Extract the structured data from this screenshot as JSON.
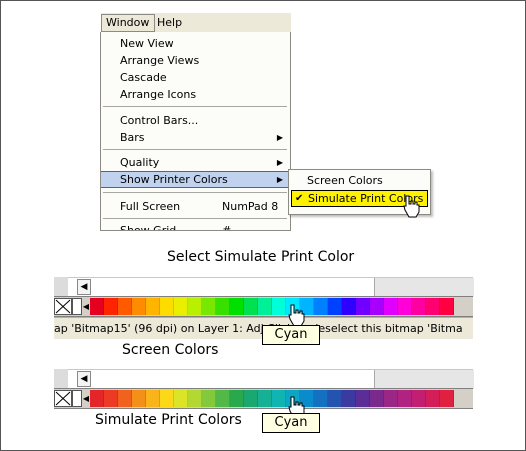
{
  "menubar": {
    "items": [
      "Window",
      "Help"
    ]
  },
  "window_menu": {
    "items": [
      {
        "label": "New View"
      },
      {
        "label": "Arrange Views"
      },
      {
        "label": "Cascade"
      },
      {
        "label": "Arrange Icons"
      },
      {
        "label": "Control Bars..."
      },
      {
        "label": "Bars",
        "submenu": true
      },
      {
        "label": "Quality",
        "submenu": true
      },
      {
        "label": "Show Printer Colors",
        "submenu": true,
        "highlighted": true
      },
      {
        "label": "Full Screen",
        "accelerator": "NumPad 8"
      },
      {
        "label": "Show Grid",
        "accelerator": "#"
      }
    ]
  },
  "printer_colors_submenu": {
    "items": [
      {
        "label": "Screen Colors",
        "checked": false
      },
      {
        "label": "Simulate Print Colors",
        "checked": true,
        "highlighted": true
      }
    ]
  },
  "captions": {
    "top": "Select Simulate Print Color",
    "screen": "Screen Colors",
    "simulate": "Simulate Print Colors"
  },
  "status_text": "ap 'Bitmap15' (96 dpi) on Layer 1: Adj          Click to deselect this bitmap 'Bitma",
  "tooltip_text": "Cyan",
  "screen_palette_colors": [
    "#e6001f",
    "#ff2400",
    "#ff5a00",
    "#ff8c00",
    "#ffb400",
    "#ffdc00",
    "#e8f000",
    "#b8f000",
    "#78e800",
    "#38e000",
    "#00e000",
    "#00e050",
    "#00f098",
    "#00ffd8",
    "#00e8ff",
    "#00b4ff",
    "#0080ff",
    "#0040ff",
    "#3000ff",
    "#7000ff",
    "#a800ff",
    "#e000ff",
    "#ff00d8",
    "#ff00a0",
    "#ff0070",
    "#ff0040"
  ],
  "print_palette_colors": [
    "#e4262a",
    "#ec3a24",
    "#f0621e",
    "#f4901a",
    "#f8b418",
    "#fcd818",
    "#dce428",
    "#b4d832",
    "#84c83c",
    "#52b848",
    "#2aa84c",
    "#1aa870",
    "#16b094",
    "#10b4b0",
    "#0ca6c4",
    "#0a8ccc",
    "#1470c0",
    "#2454b0",
    "#3a3aa0",
    "#5a2e96",
    "#7a2a8c",
    "#9a2686",
    "#b22280",
    "#c21e72",
    "#d41e5a",
    "#e02040"
  ]
}
